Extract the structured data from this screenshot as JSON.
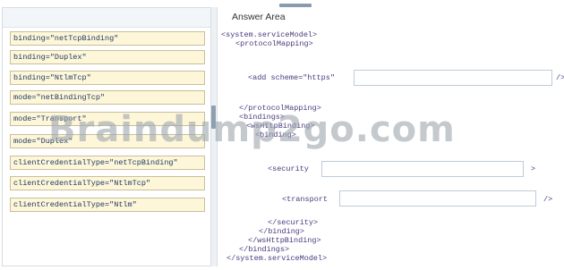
{
  "answer_area": {
    "title": "Answer Area"
  },
  "options": [
    "binding=\"netTcpBinding\"",
    "binding=\"Duplex\"",
    "binding=\"NtlmTcp\"",
    "mode=\"netBindingTcp\"",
    "mode=\"Transport\"",
    "mode=\"Duplex\"",
    "clientCredentialType=\"netTcpBinding\"",
    "clientCredentialType=\"NtlmTcp\"",
    "clientCredentialType=\"Ntlm\""
  ],
  "code": {
    "line1": "<system.serviceModel>",
    "line2": "<protocolMapping>",
    "add_prefix": "<add scheme=\"https\"",
    "add_suffix": "/>",
    "line4": "</protocolMapping>",
    "line5": "<bindings>",
    "line6": "<wsHttpBinding>",
    "line7": "<binding>",
    "security_prefix": "<security",
    "security_suffix": ">",
    "transport_prefix": "<transport",
    "transport_suffix": "/>",
    "line10": "</security>",
    "line11": "</binding>",
    "line12": "</wsHttpBinding>",
    "line13": "</bindings>",
    "line14": "</system.serviceModel>"
  },
  "watermark": "Braindump2go.com"
}
